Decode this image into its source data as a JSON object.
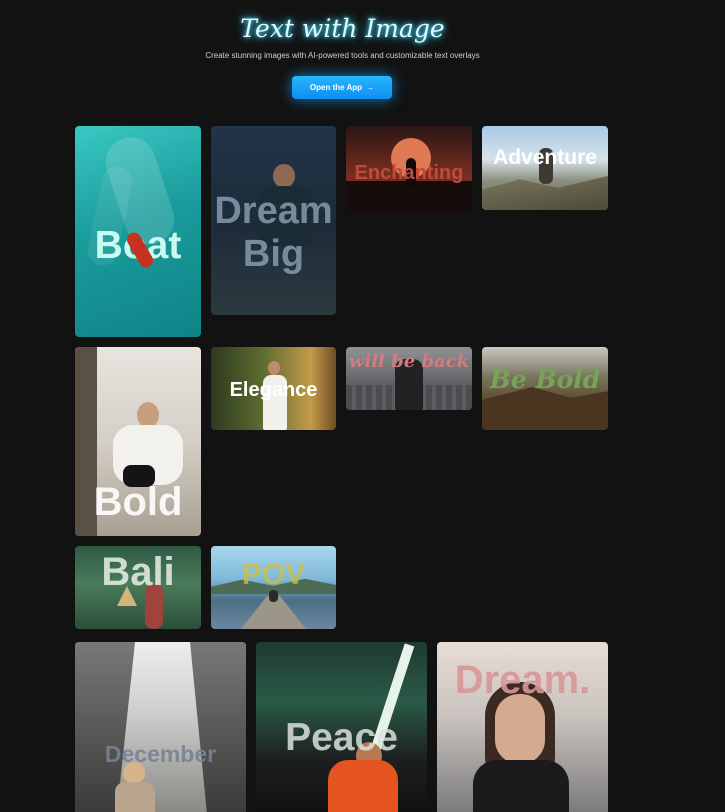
{
  "header": {
    "title": "Text with Image",
    "subtitle": "Create stunning images with AI-powered tools and customizable text overlays",
    "cta_label": "Open the App",
    "cta_icon": "arrow-right-icon"
  },
  "gallery": [
    {
      "overlay": "Boat",
      "scene": "teal water with red boat"
    },
    {
      "overlay": "Dream\nBig",
      "scene": "man in dark forest"
    },
    {
      "overlay": "Enchanting",
      "scene": "silhouette at sunset"
    },
    {
      "overlay": "Adventure",
      "scene": "hiker on mountain"
    },
    {
      "overlay": "Bold",
      "scene": "woman seated in white"
    },
    {
      "overlay": "Elegance",
      "scene": "woman in white dress"
    },
    {
      "overlay": "will be back",
      "scene": "man over city"
    },
    {
      "overlay": "Be Bold",
      "scene": "mountain overlook"
    },
    {
      "overlay": "Bali",
      "scene": "woman in green field"
    },
    {
      "overlay": "POV",
      "scene": "person on pier at lake"
    },
    {
      "overlay": "December",
      "scene": "woman on tree-lined street"
    },
    {
      "overlay": "Peace",
      "scene": "woman in orange jacket"
    },
    {
      "overlay": "Dream.",
      "scene": "woman portrait on road"
    }
  ]
}
